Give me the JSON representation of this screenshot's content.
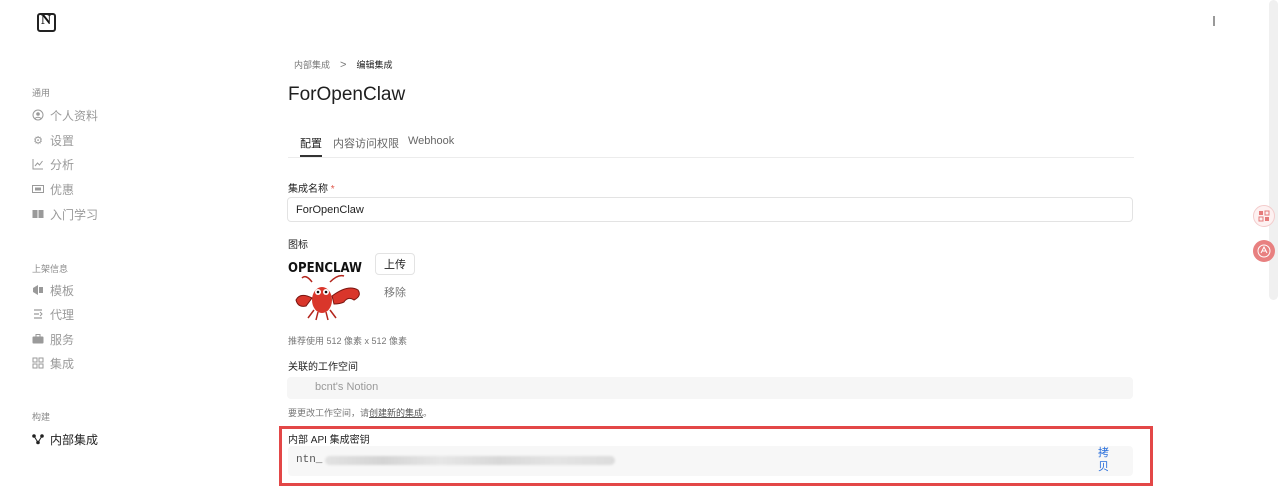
{
  "sidebar": {
    "logo_text": "N",
    "sections": [
      {
        "label": "通用"
      },
      {
        "label": "上架信息"
      },
      {
        "label": "构建"
      }
    ],
    "items": [
      {
        "label": "个人资料",
        "icon": "user-circle-icon"
      },
      {
        "label": "设置",
        "icon": "gear-icon"
      },
      {
        "label": "分析",
        "icon": "chart-line-icon"
      },
      {
        "label": "优惠",
        "icon": "ticket-icon"
      },
      {
        "label": "入门学习",
        "icon": "book-icon"
      },
      {
        "label": "模板",
        "icon": "template-icon"
      },
      {
        "label": "代理",
        "icon": "agent-icon"
      },
      {
        "label": "服务",
        "icon": "briefcase-icon"
      },
      {
        "label": "集成",
        "icon": "grid-icon"
      },
      {
        "label": "内部集成",
        "icon": "nodes-icon"
      }
    ]
  },
  "breadcrumb": {
    "parent": "内部集成",
    "separator": ">",
    "current": "编辑集成"
  },
  "page_title": "ForOpenClaw",
  "tabs": [
    {
      "label": "配置"
    },
    {
      "label": "内容访问权限"
    },
    {
      "label": "Webhook"
    }
  ],
  "form": {
    "name_label": "集成名称",
    "required_mark": "*",
    "name_value": "ForOpenClaw",
    "icon_label": "图标",
    "icon_logo_text": "OPENCLAW",
    "upload_label": "上传",
    "remove_label": "移除",
    "icon_hint": "推荐使用 512 像素 x 512 像素",
    "workspace_label": "关联的工作空间",
    "workspace_value": "bcnt's Notion",
    "workspace_hint_prefix": "要更改工作空间，请",
    "workspace_hint_link": "创建新的集成",
    "workspace_hint_suffix": "。",
    "api_label": "内部 API 集成密钥",
    "api_key_prefix": "ntn_",
    "copy_label": "拷贝"
  },
  "colors": {
    "highlight_border": "#e34747",
    "link": "#2a6fdb"
  }
}
